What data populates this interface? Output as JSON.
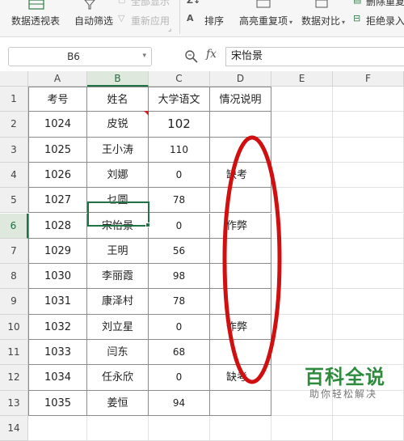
{
  "ribbon": {
    "pivot_label": "数据透视表",
    "autofilter_label": "自动筛选",
    "show_all_label": "全部显示",
    "reapply_label": "重新应用",
    "sort_label": "排序",
    "highlight_dup_label": "高亮重复项",
    "compare_label": "数据对比",
    "delete_dup_label": "删除重复项",
    "reject_dup_label": "拒绝录入"
  },
  "formula_bar": {
    "name_box": "B6",
    "fx": "fx",
    "value": "宋怡景"
  },
  "columns": [
    "A",
    "B",
    "C",
    "D",
    "E",
    "F"
  ],
  "rows": [
    "1",
    "2",
    "3",
    "4",
    "5",
    "6",
    "7",
    "8",
    "9",
    "10",
    "11",
    "12",
    "13",
    "14"
  ],
  "table": {
    "headers": [
      "考号",
      "姓名",
      "大学语文",
      "情况说明"
    ],
    "records": [
      {
        "id": "1024",
        "name": "皮锐",
        "score": "102",
        "note": ""
      },
      {
        "id": "1025",
        "name": "王小涛",
        "score": "110",
        "note": ""
      },
      {
        "id": "1026",
        "name": "刘娜",
        "score": "0",
        "note": "缺考"
      },
      {
        "id": "1027",
        "name": "乜圆",
        "score": "78",
        "note": ""
      },
      {
        "id": "1028",
        "name": "宋怡景",
        "score": "0",
        "note": "作弊"
      },
      {
        "id": "1029",
        "name": "王明",
        "score": "56",
        "note": ""
      },
      {
        "id": "1030",
        "name": "李丽霞",
        "score": "98",
        "note": ""
      },
      {
        "id": "1031",
        "name": "康泽村",
        "score": "78",
        "note": ""
      },
      {
        "id": "1032",
        "name": "刘立星",
        "score": "0",
        "note": "作弊"
      },
      {
        "id": "1033",
        "name": "闫东",
        "score": "68",
        "note": ""
      },
      {
        "id": "1034",
        "name": "任永欣",
        "score": "0",
        "note": "缺考"
      },
      {
        "id": "1035",
        "name": "姜恒",
        "score": "94",
        "note": ""
      }
    ]
  },
  "selected_cell": "B6",
  "watermark": {
    "title": "百科全说",
    "subtitle": "助你轻松解决"
  },
  "colors": {
    "accent": "#217346",
    "annotation": "#d01010",
    "comment_marker": "#d02020"
  }
}
